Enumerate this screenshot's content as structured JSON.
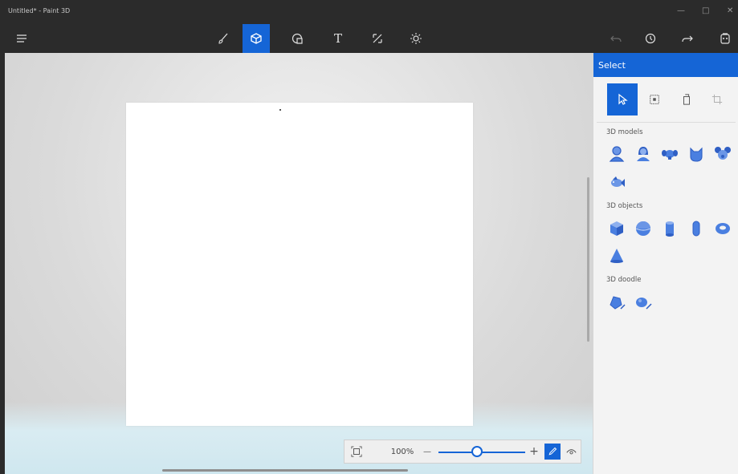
{
  "window": {
    "title": "Untitled* - Paint 3D"
  },
  "toolbar": {
    "tools": [
      {
        "name": "brushes-tool",
        "icon": "brush-icon"
      },
      {
        "name": "3d-shapes-tool",
        "icon": "cube-icon",
        "active": true
      },
      {
        "name": "2d-shapes-tool",
        "icon": "shape-icon"
      },
      {
        "name": "text-tool",
        "icon": "text-icon",
        "label": "T"
      },
      {
        "name": "canvas-tool",
        "icon": "canvas-icon"
      },
      {
        "name": "effects-tool",
        "icon": "sun-icon"
      }
    ],
    "right": [
      "undo-icon",
      "history-icon",
      "redo-icon",
      "paste-icon"
    ]
  },
  "panel": {
    "header": "Select",
    "sections": [
      {
        "label": "3D models",
        "items": [
          "man-icon",
          "woman-icon",
          "dog-icon",
          "cat-icon",
          "teddy-icon",
          "fish-icon"
        ]
      },
      {
        "label": "3D objects",
        "items": [
          "cube-icon",
          "sphere-icon",
          "cylinder-icon",
          "capsule-icon",
          "donut-icon",
          "cone-icon"
        ]
      },
      {
        "label": "3D doodle",
        "items": [
          "sharp-doodle-icon",
          "soft-doodle-icon"
        ]
      }
    ]
  },
  "zoom": {
    "value": "100%",
    "minus": "—",
    "plus": "+"
  },
  "colors": {
    "accent": "#1565d6",
    "icon_blue": "#3a6fd8",
    "dark_bar": "#2b2b2b"
  }
}
